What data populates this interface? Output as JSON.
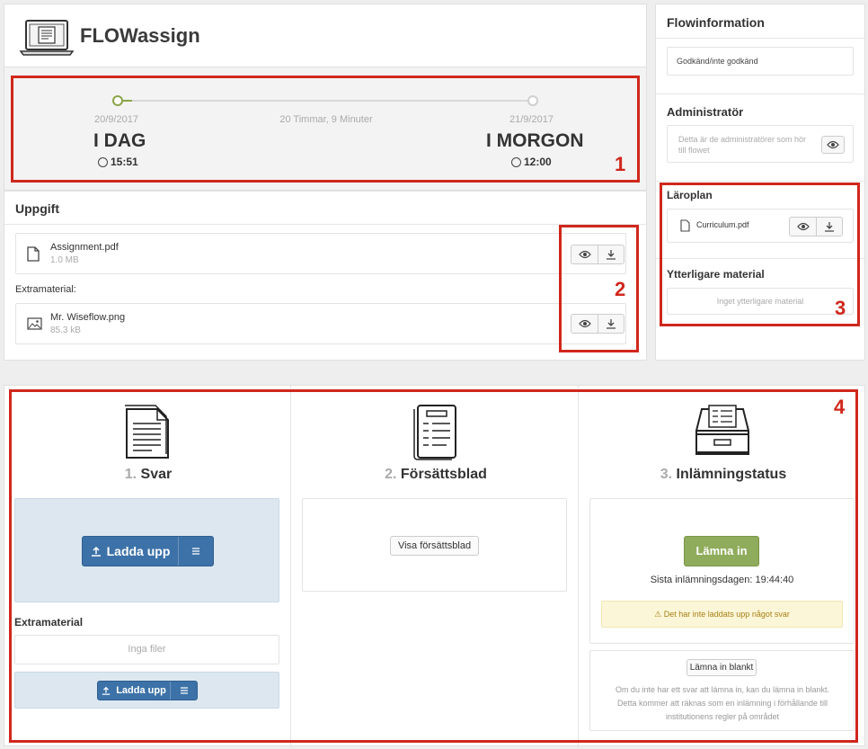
{
  "header": {
    "app_title": "FLOWassign"
  },
  "timeline": {
    "start_date": "20/9/2017",
    "duration": "20 Timmar, 9 Minuter",
    "end_date": "21/9/2017",
    "start_label": "I DAG",
    "end_label": "I MORGON",
    "start_time": "15:51",
    "end_time": "12:00"
  },
  "task": {
    "title": "Uppgift",
    "assignment": {
      "name": "Assignment.pdf",
      "size": "1.0 MB"
    },
    "extra_label": "Extramaterial:",
    "extra_file": {
      "name": "Mr. Wiseflow.png",
      "size": "85.3 kB"
    }
  },
  "sidebar": {
    "title": "Flowinformation",
    "grading": "Godkänd/inte godkänd",
    "admin_title": "Administratör",
    "admin_text": "Detta är de administratörer som hör till flowet",
    "curriculum_title": "Läroplan",
    "curriculum_file": "Curriculum.pdf",
    "extra_title": "Ytterligare material",
    "extra_empty": "Inget ytterligare material"
  },
  "steps": {
    "answer": {
      "num": "1.",
      "title": "Svar",
      "upload_label": "Ladda upp",
      "extra_title": "Extramaterial",
      "extra_empty": "Inga filer",
      "extra_upload_label": "Ladda upp"
    },
    "cover": {
      "num": "2.",
      "title": "Försättsblad",
      "button": "Visa försättsblad"
    },
    "status": {
      "num": "3.",
      "title": "Inlämningstatus",
      "submit_label": "Lämna in",
      "deadline": "Sista inlämningsdagen: 19:44:40",
      "warning": "Det har inte laddats upp något svar",
      "blank_button": "Lämna in blankt",
      "blank_text": "Om du inte har ett svar att lämna in, kan du lämna in blankt. Detta kommer att räknas som en inlämning i förhållande till institutionens regler på området"
    }
  },
  "annotations": [
    "1",
    "2",
    "3",
    "4"
  ],
  "colors": {
    "accent_green": "#8aa34b",
    "upload_blue": "#3d72a8",
    "annotation_red": "#d0271c"
  }
}
